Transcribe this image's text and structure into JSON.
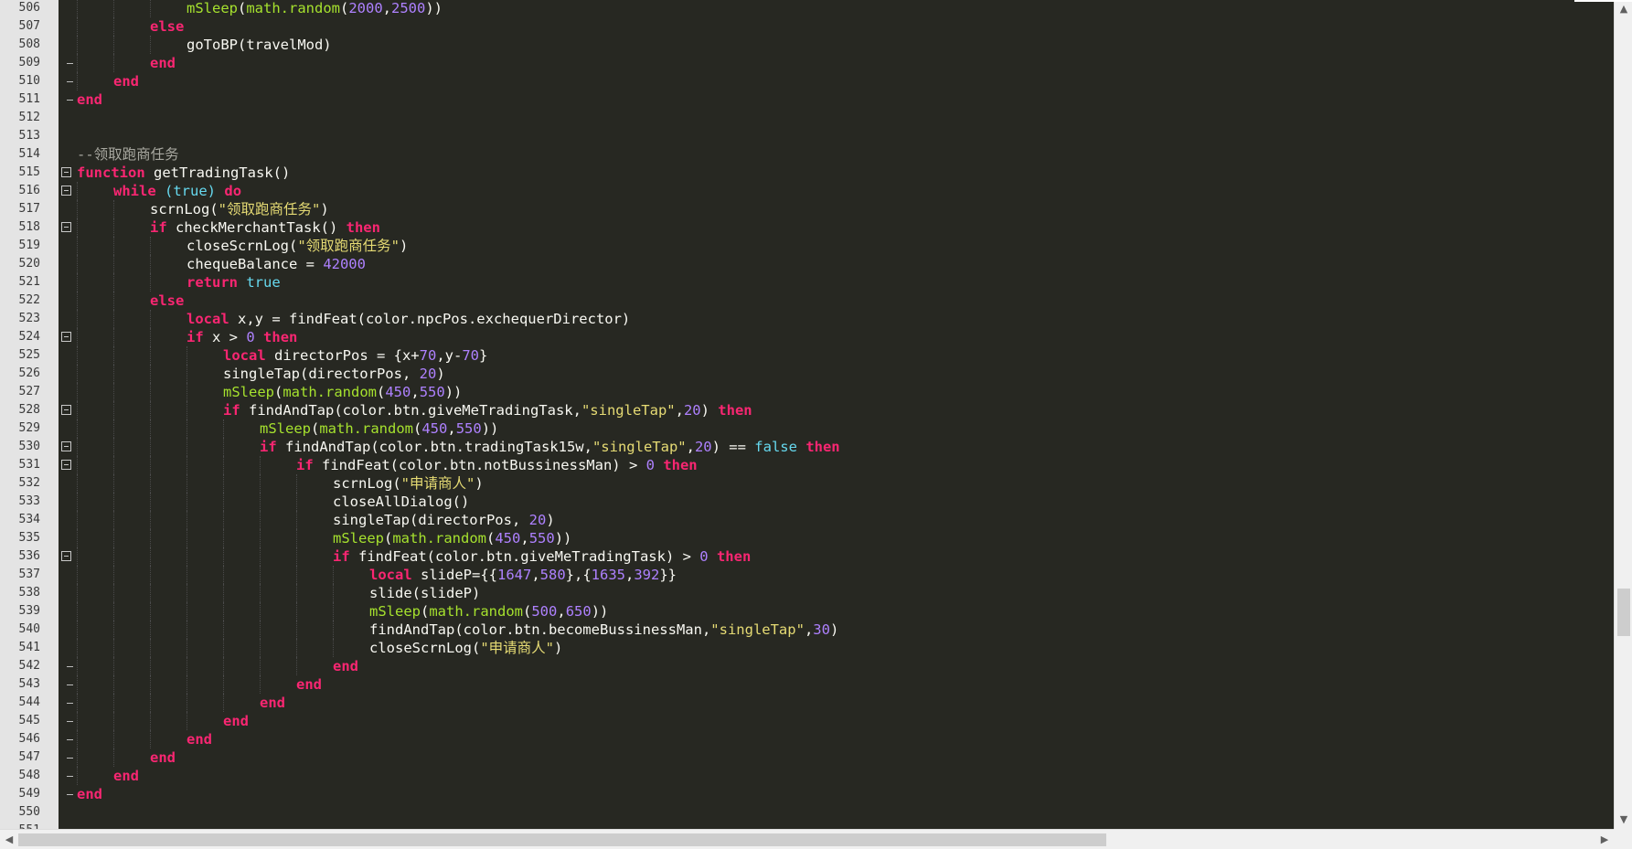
{
  "editor": {
    "theme_colors": {
      "background": "#272822",
      "gutter": "#e4e4e4",
      "keyword": "#f92672",
      "function": "#a6e22e",
      "string": "#e6db74",
      "number": "#ae81ff",
      "boolean": "#66d9ef",
      "comment": "#a8a8a0",
      "plain": "#f8f8f2"
    },
    "lines": [
      {
        "num": "506",
        "indent": 3,
        "fold": "",
        "guides": 3,
        "tokens": [
          [
            "fn",
            "mSleep"
          ],
          [
            "op",
            "("
          ],
          [
            "fn",
            "math.random"
          ],
          [
            "op",
            "("
          ],
          [
            "num",
            "2000"
          ],
          [
            "op",
            ","
          ],
          [
            "num",
            "2500"
          ],
          [
            "op",
            "))"
          ]
        ]
      },
      {
        "num": "507",
        "indent": 2,
        "fold": "",
        "guides": 2,
        "tokens": [
          [
            "kw",
            "else"
          ]
        ]
      },
      {
        "num": "508",
        "indent": 3,
        "fold": "",
        "guides": 3,
        "tokens": [
          [
            "op",
            "goToBP(travelMod)"
          ]
        ]
      },
      {
        "num": "509",
        "indent": 2,
        "fold": "end",
        "guides": 2,
        "tokens": [
          [
            "kw",
            "end"
          ]
        ]
      },
      {
        "num": "510",
        "indent": 1,
        "fold": "end",
        "guides": 1,
        "tokens": [
          [
            "kw",
            "end"
          ]
        ]
      },
      {
        "num": "511",
        "indent": 0,
        "fold": "end",
        "guides": 0,
        "tokens": [
          [
            "kw",
            "end"
          ]
        ]
      },
      {
        "num": "512",
        "indent": 0,
        "fold": "",
        "guides": 0,
        "tokens": []
      },
      {
        "num": "513",
        "indent": 0,
        "fold": "",
        "guides": 0,
        "tokens": []
      },
      {
        "num": "514",
        "indent": 0,
        "fold": "",
        "guides": 0,
        "tokens": [
          [
            "cmt",
            "--领取跑商任务"
          ]
        ]
      },
      {
        "num": "515",
        "indent": 0,
        "fold": "open",
        "guides": 0,
        "tokens": [
          [
            "kw",
            "function"
          ],
          [
            "op",
            " getTradingTask()"
          ]
        ]
      },
      {
        "num": "516",
        "indent": 1,
        "fold": "open",
        "guides": 1,
        "tokens": [
          [
            "kw",
            "while"
          ],
          [
            "op",
            " "
          ],
          [
            "bool",
            "(true)"
          ],
          [
            "op",
            " "
          ],
          [
            "kw",
            "do"
          ]
        ]
      },
      {
        "num": "517",
        "indent": 2,
        "fold": "",
        "guides": 2,
        "tokens": [
          [
            "op",
            "scrnLog("
          ],
          [
            "str",
            "\"领取跑商任务\""
          ],
          [
            "op",
            ")"
          ]
        ]
      },
      {
        "num": "518",
        "indent": 2,
        "fold": "open",
        "guides": 2,
        "tokens": [
          [
            "kw",
            "if"
          ],
          [
            "op",
            " checkMerchantTask() "
          ],
          [
            "kw",
            "then"
          ]
        ]
      },
      {
        "num": "519",
        "indent": 3,
        "fold": "",
        "guides": 3,
        "tokens": [
          [
            "op",
            "closeScrnLog("
          ],
          [
            "str",
            "\"领取跑商任务\""
          ],
          [
            "op",
            ")"
          ]
        ]
      },
      {
        "num": "520",
        "indent": 3,
        "fold": "",
        "guides": 3,
        "tokens": [
          [
            "op",
            "chequeBalance = "
          ],
          [
            "num",
            "42000"
          ]
        ]
      },
      {
        "num": "521",
        "indent": 3,
        "fold": "",
        "guides": 3,
        "tokens": [
          [
            "kw",
            "return"
          ],
          [
            "op",
            " "
          ],
          [
            "bool",
            "true"
          ]
        ]
      },
      {
        "num": "522",
        "indent": 2,
        "fold": "",
        "guides": 2,
        "tokens": [
          [
            "kw",
            "else"
          ]
        ]
      },
      {
        "num": "523",
        "indent": 3,
        "fold": "",
        "guides": 3,
        "tokens": [
          [
            "kw",
            "local"
          ],
          [
            "op",
            " x,y = findFeat(color.npcPos.exchequerDirector)"
          ]
        ]
      },
      {
        "num": "524",
        "indent": 3,
        "fold": "open",
        "guides": 3,
        "tokens": [
          [
            "kw",
            "if"
          ],
          [
            "op",
            " x > "
          ],
          [
            "num",
            "0"
          ],
          [
            "op",
            " "
          ],
          [
            "kw",
            "then"
          ]
        ]
      },
      {
        "num": "525",
        "indent": 4,
        "fold": "",
        "guides": 4,
        "tokens": [
          [
            "kw",
            "local"
          ],
          [
            "op",
            " directorPos = {x+"
          ],
          [
            "num",
            "70"
          ],
          [
            "op",
            ",y-"
          ],
          [
            "num",
            "70"
          ],
          [
            "op",
            "}"
          ]
        ]
      },
      {
        "num": "526",
        "indent": 4,
        "fold": "",
        "guides": 4,
        "tokens": [
          [
            "op",
            "singleTap(directorPos, "
          ],
          [
            "num",
            "20"
          ],
          [
            "op",
            ")"
          ]
        ]
      },
      {
        "num": "527",
        "indent": 4,
        "fold": "",
        "guides": 4,
        "tokens": [
          [
            "fn",
            "mSleep"
          ],
          [
            "op",
            "("
          ],
          [
            "fn",
            "math.random"
          ],
          [
            "op",
            "("
          ],
          [
            "num",
            "450"
          ],
          [
            "op",
            ","
          ],
          [
            "num",
            "550"
          ],
          [
            "op",
            "))"
          ]
        ]
      },
      {
        "num": "528",
        "indent": 4,
        "fold": "open",
        "guides": 4,
        "tokens": [
          [
            "kw",
            "if"
          ],
          [
            "op",
            " findAndTap(color.btn.giveMeTradingTask,"
          ],
          [
            "str",
            "\"singleTap\""
          ],
          [
            "op",
            ","
          ],
          [
            "num",
            "20"
          ],
          [
            "op",
            ") "
          ],
          [
            "kw",
            "then"
          ]
        ]
      },
      {
        "num": "529",
        "indent": 5,
        "fold": "",
        "guides": 5,
        "tokens": [
          [
            "fn",
            "mSleep"
          ],
          [
            "op",
            "("
          ],
          [
            "fn",
            "math.random"
          ],
          [
            "op",
            "("
          ],
          [
            "num",
            "450"
          ],
          [
            "op",
            ","
          ],
          [
            "num",
            "550"
          ],
          [
            "op",
            "))"
          ]
        ]
      },
      {
        "num": "530",
        "indent": 5,
        "fold": "open",
        "guides": 5,
        "tokens": [
          [
            "kw",
            "if"
          ],
          [
            "op",
            " findAndTap(color.btn.tradingTask15w,"
          ],
          [
            "str",
            "\"singleTap\""
          ],
          [
            "op",
            ","
          ],
          [
            "num",
            "20"
          ],
          [
            "op",
            ") == "
          ],
          [
            "bool",
            "false"
          ],
          [
            "op",
            " "
          ],
          [
            "kw",
            "then"
          ]
        ]
      },
      {
        "num": "531",
        "indent": 6,
        "fold": "open",
        "guides": 6,
        "tokens": [
          [
            "kw",
            "if"
          ],
          [
            "op",
            " findFeat(color.btn.notBussinessMan) > "
          ],
          [
            "num",
            "0"
          ],
          [
            "op",
            " "
          ],
          [
            "kw",
            "then"
          ]
        ]
      },
      {
        "num": "532",
        "indent": 7,
        "fold": "",
        "guides": 7,
        "tokens": [
          [
            "op",
            "scrnLog("
          ],
          [
            "str",
            "\"申请商人\""
          ],
          [
            "op",
            ")"
          ]
        ]
      },
      {
        "num": "533",
        "indent": 7,
        "fold": "",
        "guides": 7,
        "tokens": [
          [
            "op",
            "closeAllDialog()"
          ]
        ]
      },
      {
        "num": "534",
        "indent": 7,
        "fold": "",
        "guides": 7,
        "tokens": [
          [
            "op",
            "singleTap(directorPos, "
          ],
          [
            "num",
            "20"
          ],
          [
            "op",
            ")"
          ]
        ]
      },
      {
        "num": "535",
        "indent": 7,
        "fold": "",
        "guides": 7,
        "tokens": [
          [
            "fn",
            "mSleep"
          ],
          [
            "op",
            "("
          ],
          [
            "fn",
            "math.random"
          ],
          [
            "op",
            "("
          ],
          [
            "num",
            "450"
          ],
          [
            "op",
            ","
          ],
          [
            "num",
            "550"
          ],
          [
            "op",
            "))"
          ]
        ]
      },
      {
        "num": "536",
        "indent": 7,
        "fold": "open",
        "guides": 7,
        "tokens": [
          [
            "kw",
            "if"
          ],
          [
            "op",
            " findFeat(color.btn.giveMeTradingTask) > "
          ],
          [
            "num",
            "0"
          ],
          [
            "op",
            " "
          ],
          [
            "kw",
            "then"
          ]
        ]
      },
      {
        "num": "537",
        "indent": 8,
        "fold": "",
        "guides": 8,
        "tokens": [
          [
            "kw",
            "local"
          ],
          [
            "op",
            " slideP={{"
          ],
          [
            "num",
            "1647"
          ],
          [
            "op",
            ","
          ],
          [
            "num",
            "580"
          ],
          [
            "op",
            "},{"
          ],
          [
            "num",
            "1635"
          ],
          [
            "op",
            ","
          ],
          [
            "num",
            "392"
          ],
          [
            "op",
            "}}"
          ]
        ]
      },
      {
        "num": "538",
        "indent": 8,
        "fold": "",
        "guides": 8,
        "tokens": [
          [
            "op",
            "slide(slideP)"
          ]
        ]
      },
      {
        "num": "539",
        "indent": 8,
        "fold": "",
        "guides": 8,
        "tokens": [
          [
            "fn",
            "mSleep"
          ],
          [
            "op",
            "("
          ],
          [
            "fn",
            "math.random"
          ],
          [
            "op",
            "("
          ],
          [
            "num",
            "500"
          ],
          [
            "op",
            ","
          ],
          [
            "num",
            "650"
          ],
          [
            "op",
            "))"
          ]
        ]
      },
      {
        "num": "540",
        "indent": 8,
        "fold": "",
        "guides": 8,
        "tokens": [
          [
            "op",
            "findAndTap(color.btn.becomeBussinessMan,"
          ],
          [
            "str",
            "\"singleTap\""
          ],
          [
            "op",
            ","
          ],
          [
            "num",
            "30"
          ],
          [
            "op",
            ")"
          ]
        ]
      },
      {
        "num": "541",
        "indent": 8,
        "fold": "",
        "guides": 8,
        "tokens": [
          [
            "op",
            "closeScrnLog("
          ],
          [
            "str",
            "\"申请商人\""
          ],
          [
            "op",
            ")"
          ]
        ]
      },
      {
        "num": "542",
        "indent": 7,
        "fold": "end",
        "guides": 7,
        "tokens": [
          [
            "kw",
            "end"
          ]
        ]
      },
      {
        "num": "543",
        "indent": 6,
        "fold": "end",
        "guides": 6,
        "tokens": [
          [
            "kw",
            "end"
          ]
        ]
      },
      {
        "num": "544",
        "indent": 5,
        "fold": "end",
        "guides": 5,
        "tokens": [
          [
            "kw",
            "end"
          ]
        ]
      },
      {
        "num": "545",
        "indent": 4,
        "fold": "end",
        "guides": 4,
        "tokens": [
          [
            "kw",
            "end"
          ]
        ]
      },
      {
        "num": "546",
        "indent": 3,
        "fold": "end",
        "guides": 3,
        "tokens": [
          [
            "kw",
            "end"
          ]
        ]
      },
      {
        "num": "547",
        "indent": 2,
        "fold": "end",
        "guides": 2,
        "tokens": [
          [
            "kw",
            "end"
          ]
        ]
      },
      {
        "num": "548",
        "indent": 1,
        "fold": "end",
        "guides": 1,
        "tokens": [
          [
            "kw",
            "end"
          ]
        ]
      },
      {
        "num": "549",
        "indent": 0,
        "fold": "end",
        "guides": 0,
        "tokens": [
          [
            "kw",
            "end"
          ]
        ]
      },
      {
        "num": "550",
        "indent": 0,
        "fold": "",
        "guides": 0,
        "tokens": []
      },
      {
        "num": "551",
        "indent": 0,
        "fold": "",
        "guides": 0,
        "tokens": []
      }
    ]
  },
  "scrollbars": {
    "vertical": {
      "up_arrow_icon": "arrow-up-icon",
      "down_arrow_icon": "arrow-down-icon",
      "thumb_position": 0.72,
      "thumb_fraction": 0.06
    },
    "horizontal": {
      "left_arrow_icon": "arrow-left-icon",
      "right_arrow_icon": "arrow-right-icon",
      "thumb_position": 0.0,
      "thumb_fraction": 0.69
    }
  }
}
